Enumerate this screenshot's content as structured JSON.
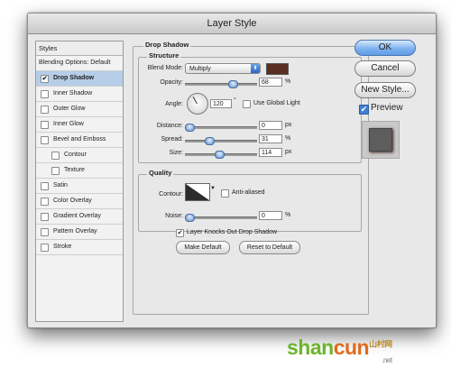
{
  "window": {
    "title": "Layer Style"
  },
  "sidebar": {
    "header": "Styles",
    "blending": "Blending Options: Default",
    "items": [
      {
        "label": "Drop Shadow",
        "checked": true
      },
      {
        "label": "Inner Shadow",
        "checked": false
      },
      {
        "label": "Outer Glow",
        "checked": false
      },
      {
        "label": "Inner Glow",
        "checked": false
      },
      {
        "label": "Bevel and Emboss",
        "checked": false
      },
      {
        "label": "Contour",
        "checked": false
      },
      {
        "label": "Texture",
        "checked": false
      },
      {
        "label": "Satin",
        "checked": false
      },
      {
        "label": "Color Overlay",
        "checked": false
      },
      {
        "label": "Gradient Overlay",
        "checked": false
      },
      {
        "label": "Pattern Overlay",
        "checked": false
      },
      {
        "label": "Stroke",
        "checked": false
      }
    ]
  },
  "drop_shadow": {
    "title": "Drop Shadow",
    "structure_title": "Structure",
    "blend_mode_label": "Blend Mode:",
    "blend_mode": "Multiply",
    "color": "#5a2e22",
    "opacity_label": "Opacity:",
    "opacity": "68",
    "opacity_unit": "%",
    "opacity_fraction": 0.68,
    "angle_label": "Angle:",
    "angle": "120",
    "angle_unit": "°",
    "global_light_label": "Use Global Light",
    "distance_label": "Distance:",
    "distance": "0",
    "distance_unit": "px",
    "distance_fraction": 0.0,
    "spread_label": "Spread:",
    "spread": "31",
    "spread_unit": "%",
    "spread_fraction": 0.31,
    "size_label": "Size:",
    "size": "114",
    "size_unit": "px",
    "size_fraction": 0.46,
    "quality_title": "Quality",
    "contour_label": "Contour:",
    "anti_aliased_label": "Anti-aliased",
    "noise_label": "Noise:",
    "noise": "0",
    "noise_unit": "%",
    "noise_fraction": 0.0,
    "knocks_out_label": "Layer Knocks Out Drop Shadow",
    "make_default_label": "Make Default",
    "reset_default_label": "Reset to Default"
  },
  "buttons": {
    "ok": "OK",
    "cancel": "Cancel",
    "new_style": "New Style...",
    "preview_label": "Preview"
  },
  "watermark": {
    "part1": "shan",
    "part2": "cun",
    "part3": ".net",
    "suffix": "山村网"
  }
}
